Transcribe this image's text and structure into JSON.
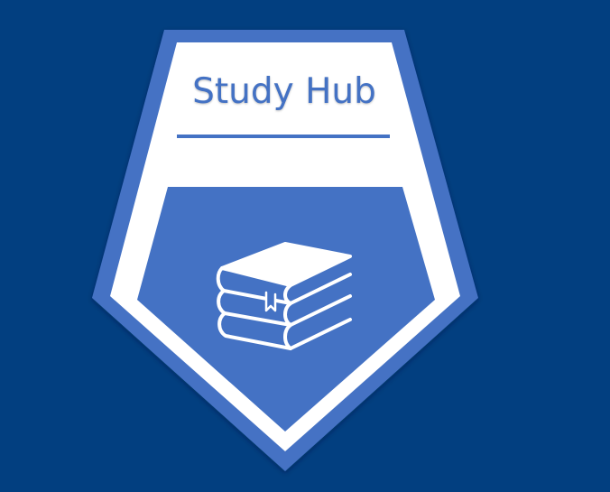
{
  "badge": {
    "title": "Study Hub",
    "icon": "stacked-books-icon"
  },
  "colors": {
    "background": "#023f80",
    "badge_border": "#4472c4",
    "badge_inner": "#ffffff",
    "badge_panel": "#4472c4",
    "title_text": "#4472c4"
  }
}
